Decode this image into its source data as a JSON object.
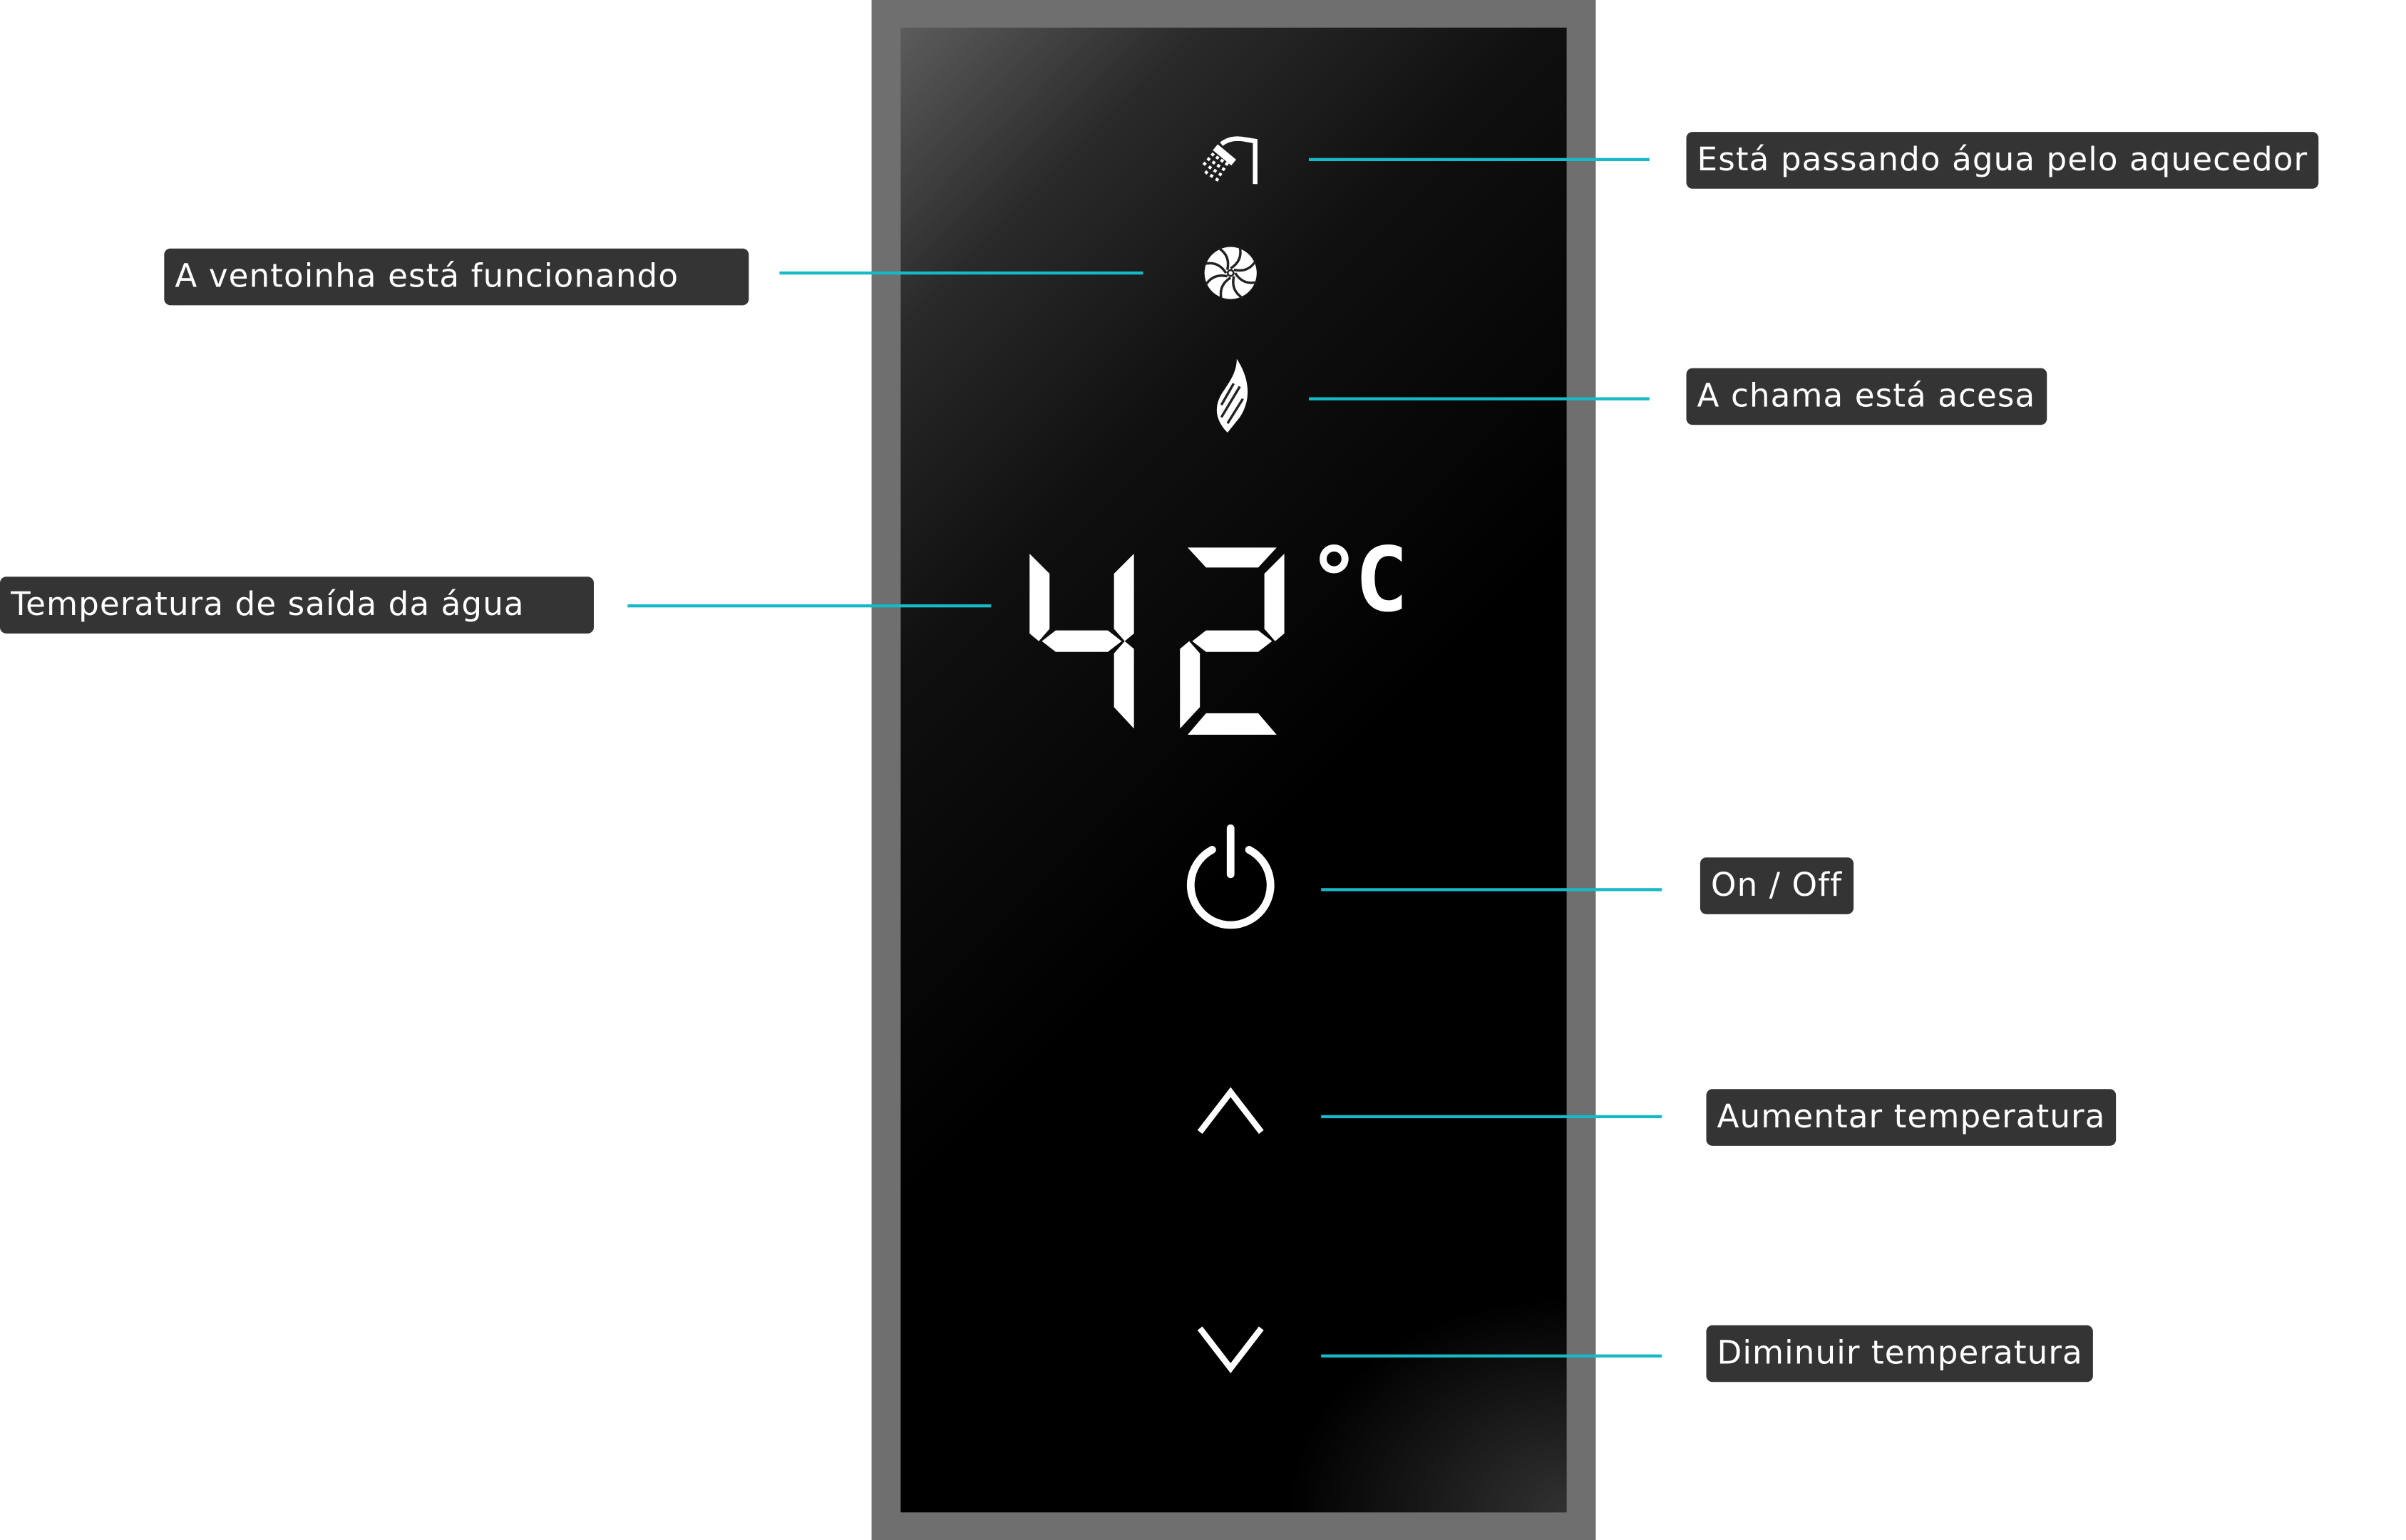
{
  "display": {
    "temperature": "42",
    "unit": "°C"
  },
  "icons": {
    "water_flow": "shower-icon",
    "fan": "fan-icon",
    "flame": "flame-icon",
    "power": "power-icon",
    "up": "chevron-up-icon",
    "down": "chevron-down-icon"
  },
  "labels": {
    "water_flow": "Está passando água pelo aquecedor",
    "fan": "A ventoinha está funcionando",
    "flame": "A chama está acesa",
    "temperature": "Temperatura de saída da água",
    "power": "On / Off",
    "increase": "Aumentar temperatura",
    "decrease": "Diminuir temperatura"
  },
  "colors": {
    "callout_line": "#16b9c6",
    "label_bg": "#343434",
    "frame": "#6f6f6f"
  }
}
